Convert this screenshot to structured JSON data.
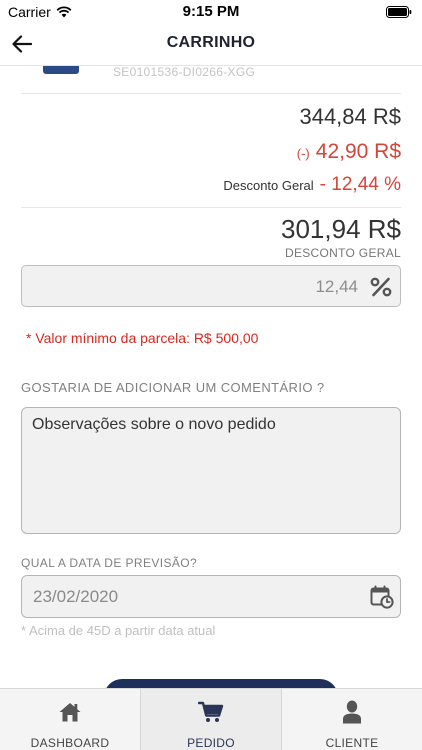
{
  "status": {
    "carrier": "Carrier",
    "time": "9:15 PM"
  },
  "nav": {
    "title": "CARRINHO"
  },
  "product": {
    "code": "SE0101536-DI0266-XGG"
  },
  "summary": {
    "subtotal": "344,84 R$",
    "discount_prefix": "(-)",
    "discount_value": "42,90 R$",
    "general_discount_label": "Desconto Geral",
    "general_discount_value": "- 12,44 %",
    "total": "301,94 R$",
    "total_caption": "DESCONTO GERAL"
  },
  "discount_field": {
    "value": "12,44",
    "icon": "percent-icon"
  },
  "warning": "* Valor mínimo da parcela: R$ 500,00",
  "comment": {
    "label": "GOSTARIA DE ADICIONAR UM COMENTÁRIO ?",
    "value": "Observações sobre o novo pedido"
  },
  "forecast": {
    "label": "QUAL A DATA DE PREVISÃO?",
    "value": "23/02/2020",
    "note": "* Acima de 45D a partir data atual",
    "icon": "calendar-clock-icon"
  },
  "tabs": [
    {
      "label": "DASHBOARD",
      "icon": "home-icon",
      "active": false
    },
    {
      "label": "PEDIDO",
      "icon": "cart-icon",
      "active": true
    },
    {
      "label": "CLIENTE",
      "icon": "user-icon",
      "active": false
    }
  ],
  "colors": {
    "accent": "#1d2f5a",
    "discount_red": "#d3463a",
    "warning_red": "#d8281f"
  }
}
